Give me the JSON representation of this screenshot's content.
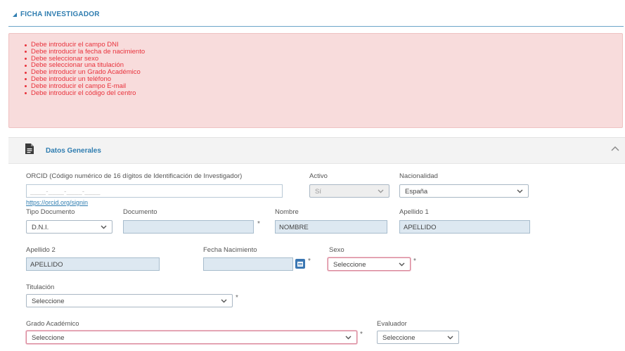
{
  "header": {
    "title": "FICHA INVESTIGADOR"
  },
  "errors": [
    "Debe introducir el campo DNI",
    "Debe introducir la fecha de nacimiento",
    "Debe seleccionar sexo",
    "Debe seleccionar una titulación",
    "Debe introducir un Grado Académico",
    "Debe introducir un teléfono",
    "Debe introducir el campo E-mail",
    "Debe introducir el código del centro"
  ],
  "panel": {
    "title": "Datos Generales"
  },
  "form": {
    "orcid": {
      "label": "ORCID (Código numérico de 16 dígitos de Identificación de Investigador)",
      "placeholder": "____-____-____-____",
      "link": "https://orcid.org/signin"
    },
    "activo": {
      "label": "Activo",
      "value": "Sí"
    },
    "nacionalidad": {
      "label": "Nacionalidad",
      "value": "España"
    },
    "tipo_documento": {
      "label": "Tipo Documento",
      "value": "D.N.I."
    },
    "documento": {
      "label": "Documento",
      "value": ""
    },
    "nombre": {
      "label": "Nombre",
      "value": "NOMBRE"
    },
    "apellido1": {
      "label": "Apellido 1",
      "value": "APELLIDO"
    },
    "apellido2": {
      "label": "Apellido 2",
      "value": "APELLIDO"
    },
    "fecha_nacimiento": {
      "label": "Fecha Nacimiento",
      "value": ""
    },
    "sexo": {
      "label": "Sexo",
      "value": "Seleccione"
    },
    "titulacion": {
      "label": "Titulación",
      "value": "Seleccione"
    },
    "grado_academico": {
      "label": "Grado Académico",
      "value": "Seleccione"
    },
    "evaluador": {
      "label": "Evaluador",
      "value": "Seleccione"
    },
    "required_mark": "*"
  },
  "icons": {
    "header": "triangle-expand-icon",
    "panel": "document-icon",
    "collapse": "chevron-up-icon",
    "calendar": "calendar-icon",
    "caret": "chevron-down-icon"
  },
  "colors": {
    "accent": "#2f7db0",
    "error_text": "#e8323c",
    "error_bg": "#f8dcdc",
    "field_filled": "#dde8f1"
  }
}
